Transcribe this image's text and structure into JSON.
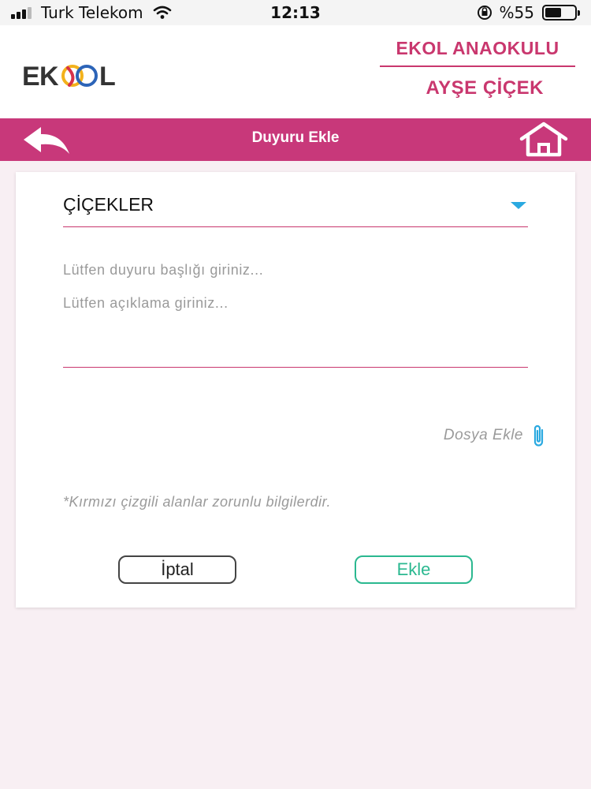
{
  "status_bar": {
    "carrier": "Turk Telekom",
    "time": "12:13",
    "battery_percent": "%55",
    "battery_level": 0.55,
    "icons": [
      "signal-icon",
      "wifi-icon",
      "orientation-lock-icon",
      "battery-icon"
    ]
  },
  "header": {
    "logo_text": "EKOL",
    "school_name": "EKOL ANAOKULU",
    "user_name": "AYŞE ÇİÇEK"
  },
  "navbar": {
    "title": "Duyuru Ekle",
    "back_icon": "back-arrow-icon",
    "home_icon": "home-icon",
    "color": "#c8387a"
  },
  "form": {
    "class_select_value": "ÇİÇEKLER",
    "title_placeholder": "Lütfen duyuru başlığı giriniz...",
    "description_placeholder": "Lütfen açıklama giriniz...",
    "attach_label": "Dosya Ekle",
    "required_note": "*Kırmızı çizgili alanlar zorunlu bilgilerdir.",
    "cancel_label": "İptal",
    "add_label": "Ekle"
  },
  "colors": {
    "accent": "#c9376e",
    "add_button": "#2bb890",
    "caret": "#2aa9e0"
  }
}
